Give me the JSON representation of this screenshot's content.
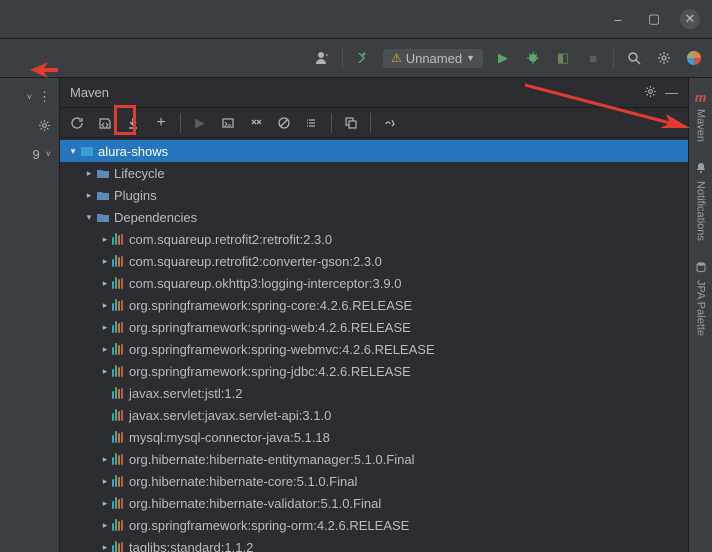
{
  "titlebar": {
    "minimize": "–",
    "maximize": "▢",
    "close": "✕"
  },
  "mainToolbar": {
    "runConfigLabel": "Unnamed"
  },
  "leftGutter": {
    "lineNumber": "9"
  },
  "panel": {
    "title": "Maven"
  },
  "tree": {
    "root": "alura-shows",
    "lifecycle": "Lifecycle",
    "plugins": "Plugins",
    "dependenciesLabel": "Dependencies",
    "deps": [
      "com.squareup.retrofit2:retrofit:2.3.0",
      "com.squareup.retrofit2:converter-gson:2.3.0",
      "com.squareup.okhttp3:logging-interceptor:3.9.0",
      "org.springframework:spring-core:4.2.6.RELEASE",
      "org.springframework:spring-web:4.2.6.RELEASE",
      "org.springframework:spring-webmvc:4.2.6.RELEASE",
      "org.springframework:spring-jdbc:4.2.6.RELEASE",
      "javax.servlet:jstl:1.2",
      "javax.servlet:javax.servlet-api:3.1.0",
      "mysql:mysql-connector-java:5.1.18",
      "org.hibernate:hibernate-entitymanager:5.1.0.Final",
      "org.hibernate:hibernate-core:5.1.0.Final",
      "org.hibernate:hibernate-validator:5.1.0.Final",
      "org.springframework:spring-orm:4.2.6.RELEASE",
      "taglibs:standard:1.1.2"
    ],
    "depsExpandable": [
      true,
      true,
      true,
      true,
      true,
      true,
      true,
      false,
      false,
      false,
      true,
      true,
      true,
      true,
      true
    ]
  },
  "rightStripe": {
    "maven": "Maven",
    "notifications": "Notifications",
    "jpa": "JPA Palette"
  }
}
